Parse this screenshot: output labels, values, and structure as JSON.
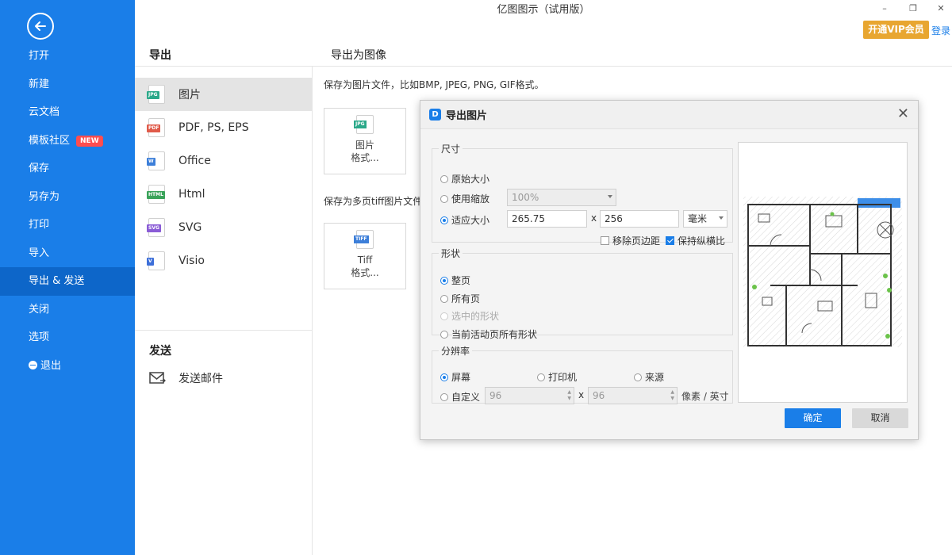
{
  "window": {
    "title": "亿图图示（试用版）",
    "vip_button": "开通VIP会员",
    "login": "登录",
    "minimize": "–",
    "restore": "❐",
    "close": "✕"
  },
  "sidebar": {
    "items": [
      {
        "label": "打开"
      },
      {
        "label": "新建"
      },
      {
        "label": "云文档"
      },
      {
        "label": "模板社区",
        "badge": "NEW"
      },
      {
        "label": "保存"
      },
      {
        "label": "另存为"
      },
      {
        "label": "打印"
      },
      {
        "label": "导入"
      },
      {
        "label": "导出 & 发送",
        "active": true
      },
      {
        "label": "关闭"
      },
      {
        "label": "选项"
      },
      {
        "label": "退出"
      }
    ]
  },
  "export_panel": {
    "heading": "导出",
    "right_heading": "导出为图像",
    "formats": [
      {
        "label": "图片",
        "tag": "JPG",
        "color": "#2aa889"
      },
      {
        "label": "PDF, PS, EPS",
        "tag": "PDF",
        "color": "#e05b4a"
      },
      {
        "label": "Office",
        "tag": "W",
        "color": "#3d7fd9"
      },
      {
        "label": "Html",
        "tag": "HTML",
        "color": "#3aa35a"
      },
      {
        "label": "SVG",
        "tag": "SVG",
        "color": "#8a5cd6"
      },
      {
        "label": "Visio",
        "tag": "V",
        "color": "#3d6fd9"
      }
    ],
    "send_heading": "发送",
    "send_mail": "发送邮件"
  },
  "content": {
    "desc_image": "保存为图片文件，比如BMP, JPEG, PNG, GIF格式。",
    "card_image": {
      "tag": "JPG",
      "line1": "图片",
      "line2": "格式..."
    },
    "desc_tiff": "保存为多页tiff图片文件。",
    "card_tiff": {
      "tag": "TIFF",
      "line1": "Tiff",
      "line2": "格式..."
    }
  },
  "dialog": {
    "title": "导出图片",
    "size_group": {
      "legend": "尺寸",
      "original": "原始大小",
      "use_zoom": "使用缩放",
      "zoom_value": "100%",
      "fit": "适应大小",
      "width": "265.75",
      "height": "256",
      "times": "x",
      "unit": "毫米",
      "remove_margin": "移除页边距",
      "keep_ratio": "保持纵横比"
    },
    "shape_group": {
      "legend": "形状",
      "whole_page": "整页",
      "all_pages": "所有页",
      "selected": "选中的形状",
      "current_active": "当前活动页所有形状"
    },
    "resolution_group": {
      "legend": "分辨率",
      "screen": "屏幕",
      "printer": "打印机",
      "source": "来源",
      "custom": "自定义",
      "dpi_x": "96",
      "dpi_y": "96",
      "times": "x",
      "unit": "像素 / 英寸"
    },
    "ok": "确定",
    "cancel": "取消"
  },
  "colors": {
    "sidebar_blue": "#1a7ee8",
    "vip_gold": "#e8a630",
    "primary": "#1a7ee8"
  }
}
